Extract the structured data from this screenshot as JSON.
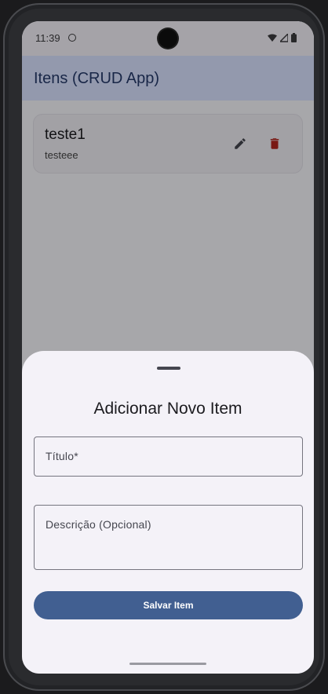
{
  "status_bar": {
    "time": "11:39"
  },
  "app_bar": {
    "title": "Itens (CRUD App)"
  },
  "items": [
    {
      "title": "teste1",
      "description": "testeee"
    }
  ],
  "sheet": {
    "title": "Adicionar Novo Item",
    "title_field_label": "Título*",
    "description_field_label": "Descrição (Opcional)",
    "save_label": "Salvar Item"
  },
  "colors": {
    "app_bar_bg": "#d9e2ff",
    "app_bar_text": "#263a6a",
    "primary_button": "#415f91",
    "delete_icon": "#b3261e"
  }
}
